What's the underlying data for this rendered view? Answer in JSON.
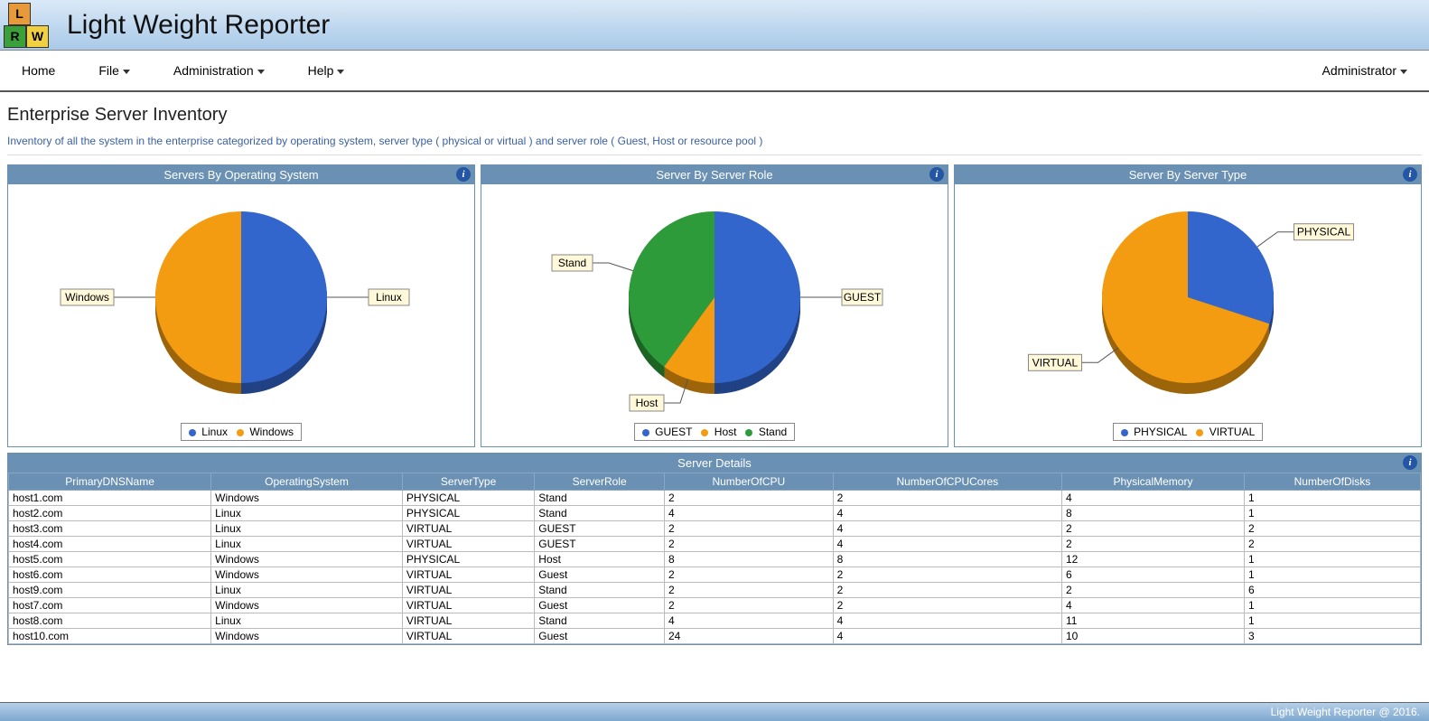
{
  "app": {
    "title": "Light Weight Reporter",
    "logo_letters": [
      "L",
      "R",
      "W"
    ]
  },
  "menu": {
    "home": "Home",
    "file": "File",
    "administration": "Administration",
    "help": "Help",
    "user": "Administrator"
  },
  "page": {
    "title": "Enterprise Server Inventory",
    "description": "Inventory of all the system in the enterprise categorized by operating system, server type ( physical or virtual ) and server role ( Guest, Host or resource pool )"
  },
  "panels": {
    "chart1_title": "Servers By Operating System",
    "chart2_title": "Server By Server Role",
    "chart3_title": "Server By Server Type",
    "table_title": "Server Details"
  },
  "chart_data": [
    {
      "id": "chart1",
      "type": "pie",
      "title": "Servers By Operating System",
      "slices": [
        {
          "name": "Linux",
          "value": 5,
          "percent": 50,
          "color": "#3366cc"
        },
        {
          "name": "Windows",
          "value": 5,
          "percent": 50,
          "color": "#f39c12"
        }
      ],
      "legend": [
        "Linux",
        "Windows"
      ]
    },
    {
      "id": "chart2",
      "type": "pie",
      "title": "Server By Server Role",
      "slices": [
        {
          "name": "GUEST",
          "value": 5,
          "percent": 50,
          "color": "#3366cc"
        },
        {
          "name": "Host",
          "value": 1,
          "percent": 10,
          "color": "#f39c12"
        },
        {
          "name": "Stand",
          "value": 4,
          "percent": 40,
          "color": "#2e9b3a"
        }
      ],
      "legend": [
        "GUEST",
        "Host",
        "Stand"
      ]
    },
    {
      "id": "chart3",
      "type": "pie",
      "title": "Server By Server Type",
      "slices": [
        {
          "name": "PHYSICAL",
          "value": 3,
          "percent": 30,
          "color": "#3366cc"
        },
        {
          "name": "VIRTUAL",
          "value": 7,
          "percent": 70,
          "color": "#f39c12"
        }
      ],
      "legend": [
        "PHYSICAL",
        "VIRTUAL"
      ]
    }
  ],
  "table": {
    "columns": [
      "PrimaryDNSName",
      "OperatingSystem",
      "ServerType",
      "ServerRole",
      "NumberOfCPU",
      "NumberOfCPUCores",
      "PhysicalMemory",
      "NumberOfDisks"
    ],
    "rows": [
      [
        "host1.com",
        "Windows",
        "PHYSICAL",
        "Stand",
        "2",
        "2",
        "4",
        "1"
      ],
      [
        "host2.com",
        "Linux",
        "PHYSICAL",
        "Stand",
        "4",
        "4",
        "8",
        "1"
      ],
      [
        "host3.com",
        "Linux",
        "VIRTUAL",
        "GUEST",
        "2",
        "4",
        "2",
        "2"
      ],
      [
        "host4.com",
        "Linux",
        "VIRTUAL",
        "GUEST",
        "2",
        "4",
        "2",
        "2"
      ],
      [
        "host5.com",
        "Windows",
        "PHYSICAL",
        "Host",
        "8",
        "8",
        "12",
        "1"
      ],
      [
        "host6.com",
        "Windows",
        "VIRTUAL",
        "Guest",
        "2",
        "2",
        "6",
        "1"
      ],
      [
        "host9.com",
        "Linux",
        "VIRTUAL",
        "Stand",
        "2",
        "2",
        "2",
        "6"
      ],
      [
        "host7.com",
        "Windows",
        "VIRTUAL",
        "Guest",
        "2",
        "2",
        "4",
        "1"
      ],
      [
        "host8.com",
        "Linux",
        "VIRTUAL",
        "Stand",
        "4",
        "4",
        "11",
        "1"
      ],
      [
        "host10.com",
        "Windows",
        "VIRTUAL",
        "Guest",
        "24",
        "4",
        "10",
        "3"
      ]
    ]
  },
  "footer": "Light Weight Reporter @ 2016."
}
